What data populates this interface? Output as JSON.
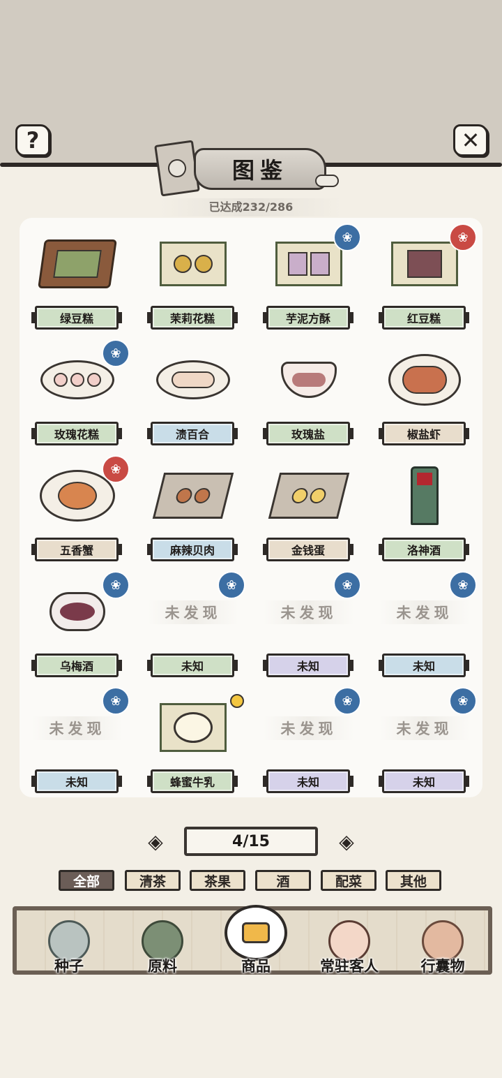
{
  "header": {
    "title": "图鉴",
    "progress": "已达成232/286",
    "help_icon": "?",
    "close_icon": "✕"
  },
  "items": [
    {
      "name": "绿豆糕",
      "art": "square-tray-cakes",
      "label_color": "green",
      "badge": ""
    },
    {
      "name": "茉莉花糕",
      "art": "bamboo-tray-flower-cakes",
      "label_color": "green",
      "badge": ""
    },
    {
      "name": "芋泥方酥",
      "art": "bamboo-tray-taro-pastry",
      "label_color": "green",
      "badge": "blue"
    },
    {
      "name": "红豆糕",
      "art": "bamboo-tray-redbean-cake",
      "label_color": "green",
      "badge": "red"
    },
    {
      "name": "玫瑰花糕",
      "art": "plate-rose-cakes",
      "label_color": "green",
      "badge": "blue"
    },
    {
      "name": "渍百合",
      "art": "plate-lily",
      "label_color": "blue",
      "badge": ""
    },
    {
      "name": "玫瑰盐",
      "art": "bowl-rose-salt",
      "label_color": "green",
      "badge": ""
    },
    {
      "name": "椒盐虾",
      "art": "plate-shrimp",
      "label_color": "tan",
      "badge": ""
    },
    {
      "name": "五香蟹",
      "art": "plate-crab",
      "label_color": "tan",
      "badge": "red"
    },
    {
      "name": "麻辣贝肉",
      "art": "tray-scallops",
      "label_color": "blue",
      "badge": ""
    },
    {
      "name": "金钱蛋",
      "art": "tray-eggs",
      "label_color": "tan",
      "badge": ""
    },
    {
      "name": "洛神酒",
      "art": "bronze-wine-cup",
      "label_color": "green",
      "badge": ""
    },
    {
      "name": "乌梅酒",
      "art": "bowl-plum-wine",
      "label_color": "green",
      "badge": "blue"
    },
    {
      "name": "未知",
      "art": "",
      "label_color": "green",
      "badge": "blue",
      "undiscovered": "未发现"
    },
    {
      "name": "未知",
      "art": "",
      "label_color": "purple",
      "badge": "blue",
      "undiscovered": "未发现"
    },
    {
      "name": "未知",
      "art": "",
      "label_color": "blue",
      "badge": "blue",
      "undiscovered": "未发现"
    },
    {
      "name": "未知",
      "art": "",
      "label_color": "blue",
      "badge": "blue",
      "undiscovered": "未发现"
    },
    {
      "name": "蜂蜜牛乳",
      "art": "bamboo-tray-milk-bowl",
      "label_color": "green",
      "badge": "bee"
    },
    {
      "name": "未知",
      "art": "",
      "label_color": "purple",
      "badge": "blue",
      "undiscovered": "未发现"
    },
    {
      "name": "未知",
      "art": "",
      "label_color": "purple",
      "badge": "blue",
      "undiscovered": "未发现"
    }
  ],
  "pager": {
    "text": "4/15",
    "prev_icon": "◈",
    "next_icon": "◈"
  },
  "tabs": [
    "全部",
    "清茶",
    "茶果",
    "酒",
    "配菜",
    "其他"
  ],
  "active_tab": "全部",
  "nav": [
    {
      "label": "种子",
      "icon": "seed-jar-icon"
    },
    {
      "label": "原料",
      "icon": "leaf-icon"
    },
    {
      "label": "商品",
      "icon": "cake-plate-icon"
    },
    {
      "label": "常驻客人",
      "icon": "girl-avatar-icon"
    },
    {
      "label": "行囊物",
      "icon": "robe-icon"
    }
  ],
  "active_nav": "商品",
  "colors": {
    "label_green": "#cfe0c6",
    "label_blue": "#c9dde8",
    "label_tan": "#e8ddcc",
    "label_purple": "#d6d2ea",
    "badge_blue": "#3c6ea3",
    "badge_red": "#c94a44"
  }
}
